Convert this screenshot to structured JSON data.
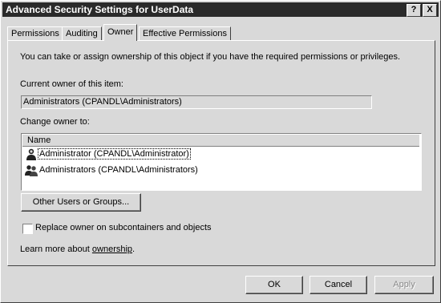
{
  "window": {
    "title": "Advanced Security Settings for UserData",
    "help_btn": "?",
    "close_btn": "X"
  },
  "tabs": [
    {
      "label": "Permissions"
    },
    {
      "label": "Auditing"
    },
    {
      "label": "Owner"
    },
    {
      "label": "Effective Permissions"
    }
  ],
  "owner": {
    "intro": "You can take or assign ownership of this object if you have the required permissions or privileges.",
    "current_owner_label": "Current owner of this item:",
    "current_owner_value": "Administrators (CPANDL\\Administrators)",
    "change_owner_label": "Change owner to:",
    "column_name": "Name",
    "items": [
      {
        "name": "Administrator (CPANDL\\Administrator)",
        "icon": "user-icon"
      },
      {
        "name": "Administrators (CPANDL\\Administrators)",
        "icon": "group-icon"
      }
    ],
    "other_users_button": "Other Users or Groups...",
    "replace_owner_label": "Replace owner on subcontainers and objects",
    "learn_more_prefix": "Learn more about ",
    "learn_more_link": "ownership",
    "learn_more_suffix": "."
  },
  "buttons": {
    "ok": "OK",
    "cancel": "Cancel",
    "apply": "Apply"
  }
}
